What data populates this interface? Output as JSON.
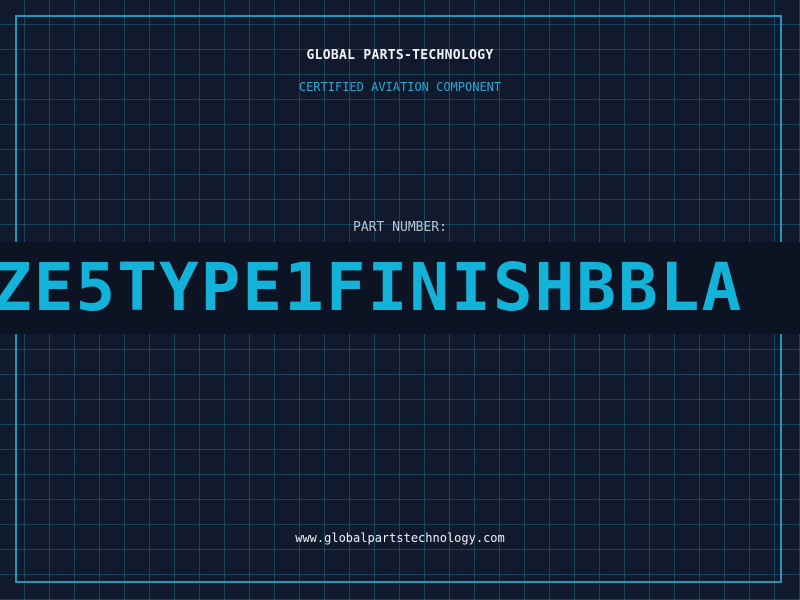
{
  "header": {
    "company": "GLOBAL PARTS-TECHNOLOGY",
    "subtitle": "CERTIFIED AVIATION COMPONENT"
  },
  "part": {
    "label": "PART NUMBER:",
    "number": "ZE5TYPE1FINISHBBLA"
  },
  "footer": {
    "url": "www.globalpartstechnology.com"
  },
  "colors": {
    "background": "#111a2d",
    "accent": "#12b2d9",
    "grid": "#28789a",
    "text": "#f2f4f6"
  }
}
